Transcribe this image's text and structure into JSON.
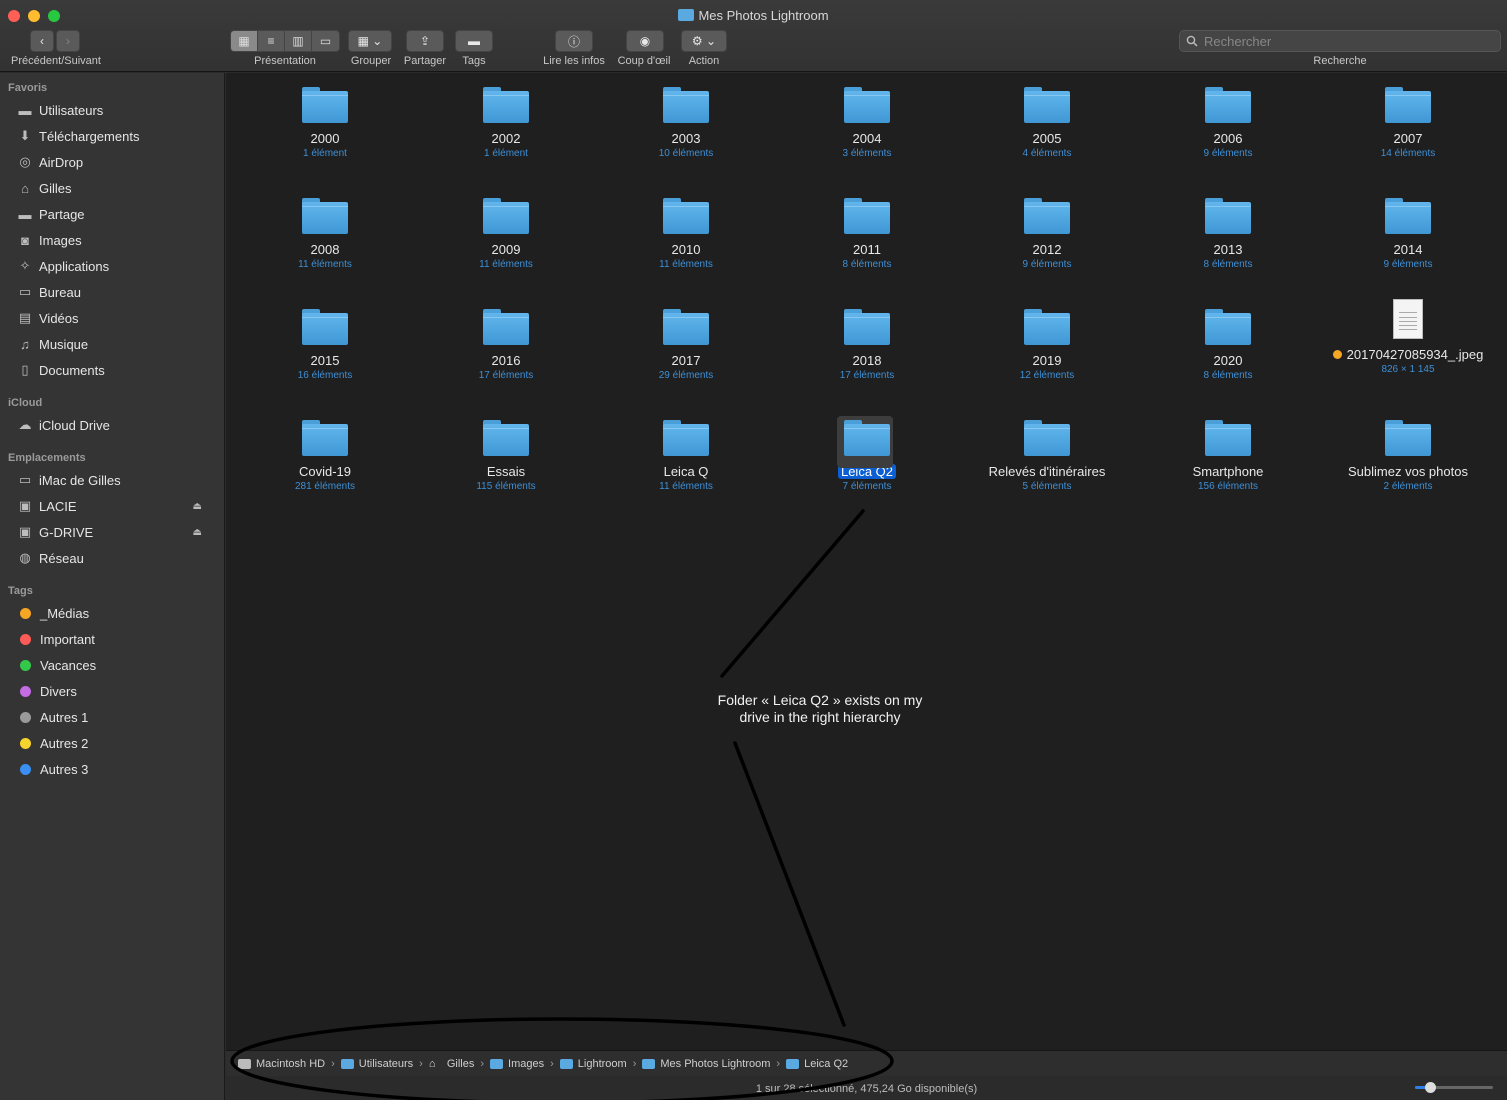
{
  "window": {
    "title": "Mes Photos Lightroom"
  },
  "toolbar": {
    "nav_label": "Précédent/Suivant",
    "view_label": "Présentation",
    "group_label": "Grouper",
    "share_label": "Partager",
    "tags_label": "Tags",
    "info_label": "Lire les infos",
    "quicklook_label": "Coup d'œil",
    "action_label": "Action",
    "search_placeholder": "Rechercher",
    "search_label": "Recherche"
  },
  "sidebar": {
    "favorites_header": "Favoris",
    "favorites": [
      {
        "label": "Utilisateurs",
        "icon": "folder-icon"
      },
      {
        "label": "Téléchargements",
        "icon": "download-icon"
      },
      {
        "label": "AirDrop",
        "icon": "airdrop-icon"
      },
      {
        "label": "Gilles",
        "icon": "home-icon"
      },
      {
        "label": "Partage",
        "icon": "folder-icon"
      },
      {
        "label": "Images",
        "icon": "camera-icon"
      },
      {
        "label": "Applications",
        "icon": "applications-icon"
      },
      {
        "label": "Bureau",
        "icon": "desktop-icon"
      },
      {
        "label": "Vidéos",
        "icon": "film-icon"
      },
      {
        "label": "Musique",
        "icon": "music-icon"
      },
      {
        "label": "Documents",
        "icon": "document-icon"
      }
    ],
    "icloud_header": "iCloud",
    "icloud": [
      {
        "label": "iCloud Drive",
        "icon": "cloud-icon"
      }
    ],
    "locations_header": "Emplacements",
    "locations": [
      {
        "label": "iMac de Gilles",
        "icon": "computer-icon"
      },
      {
        "label": "LACIE",
        "icon": "drive-icon"
      },
      {
        "label": "G-DRIVE",
        "icon": "drive-icon"
      },
      {
        "label": "Réseau",
        "icon": "network-icon"
      }
    ],
    "tags_header": "Tags",
    "tags": [
      {
        "label": "_Médias",
        "color": "#f5a623"
      },
      {
        "label": "Important",
        "color": "#fc5b57"
      },
      {
        "label": "Vacances",
        "color": "#34c84a"
      },
      {
        "label": "Divers",
        "color": "#c36ce3"
      },
      {
        "label": "Autres 1",
        "color": "#9a9a9a"
      },
      {
        "label": "Autres 2",
        "color": "#f6d32d"
      },
      {
        "label": "Autres 3",
        "color": "#3a8ff0"
      }
    ]
  },
  "items": [
    {
      "name": "2000",
      "info": "1 élément"
    },
    {
      "name": "2002",
      "info": "1 élément"
    },
    {
      "name": "2003",
      "info": "10 éléments"
    },
    {
      "name": "2004",
      "info": "3 éléments"
    },
    {
      "name": "2005",
      "info": "4 éléments"
    },
    {
      "name": "2006",
      "info": "9 éléments"
    },
    {
      "name": "2007",
      "info": "14 éléments"
    },
    {
      "name": "2008",
      "info": "11 éléments"
    },
    {
      "name": "2009",
      "info": "11 éléments"
    },
    {
      "name": "2010",
      "info": "11 éléments"
    },
    {
      "name": "2011",
      "info": "8 éléments"
    },
    {
      "name": "2012",
      "info": "9 éléments"
    },
    {
      "name": "2013",
      "info": "8 éléments"
    },
    {
      "name": "2014",
      "info": "9 éléments"
    },
    {
      "name": "2015",
      "info": "16 éléments"
    },
    {
      "name": "2016",
      "info": "17 éléments"
    },
    {
      "name": "2017",
      "info": "29 éléments"
    },
    {
      "name": "2018",
      "info": "17 éléments"
    },
    {
      "name": "2019",
      "info": "12 éléments"
    },
    {
      "name": "2020",
      "info": "8 éléments"
    },
    {
      "name": "20170427085934_.jpeg",
      "info": "826 × 1 145",
      "type": "image",
      "tag_color": "#f5a623"
    },
    {
      "name": "Covid-19",
      "info": "281 éléments"
    },
    {
      "name": "Essais",
      "info": "115 éléments"
    },
    {
      "name": "Leica Q",
      "info": "11 éléments"
    },
    {
      "name": "Leica Q2",
      "info": "7 éléments",
      "selected": true
    },
    {
      "name": "Relevés d'itinéraires",
      "info": "5 éléments"
    },
    {
      "name": "Smartphone",
      "info": "156 éléments"
    },
    {
      "name": "Sublimez vos photos",
      "info": "2 éléments"
    }
  ],
  "annotation": {
    "line1": "Folder « Leica Q2 » exists on my",
    "line2": "drive in the right hierarchy"
  },
  "pathbar": [
    {
      "label": "Macintosh HD",
      "icon": "hd"
    },
    {
      "label": "Utilisateurs",
      "icon": "folder"
    },
    {
      "label": "Gilles",
      "icon": "home"
    },
    {
      "label": "Images",
      "icon": "folder"
    },
    {
      "label": "Lightroom",
      "icon": "folder"
    },
    {
      "label": "Mes Photos Lightroom",
      "icon": "folder"
    },
    {
      "label": "Leica Q2",
      "icon": "folder"
    }
  ],
  "status": {
    "text": "1 sur 28 sélectionné, 475,24 Go disponible(s)"
  }
}
